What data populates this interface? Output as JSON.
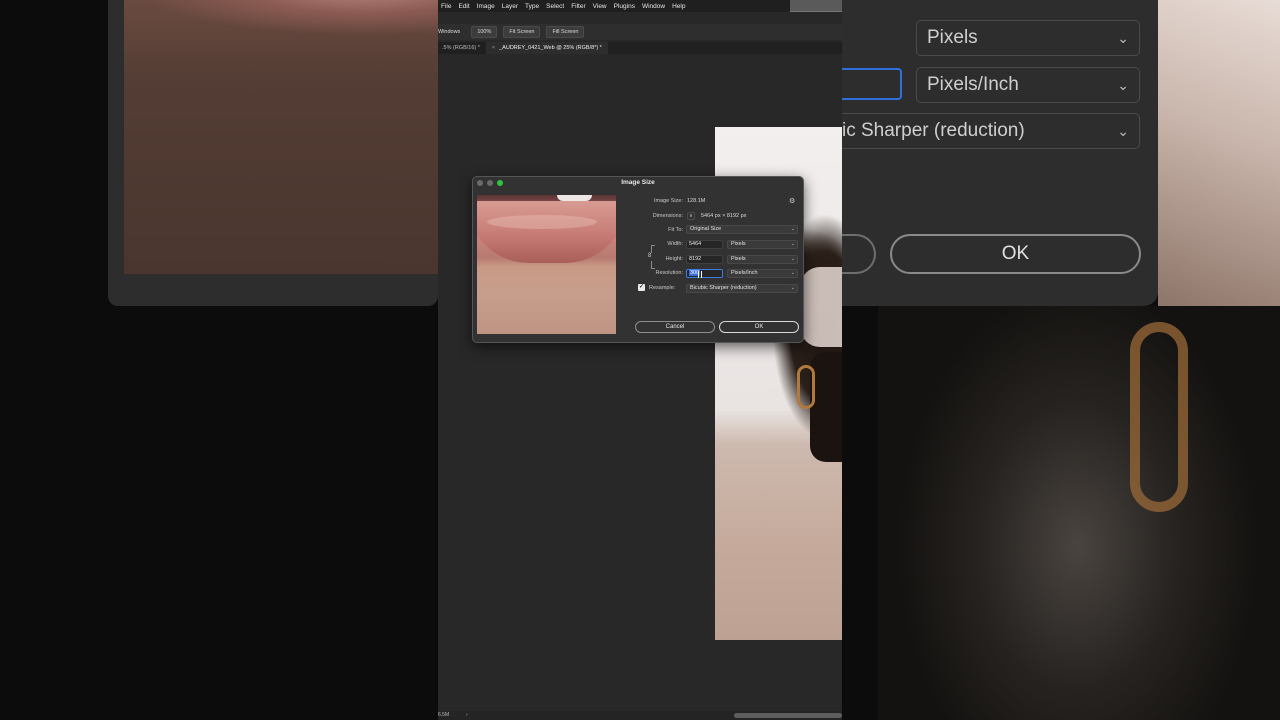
{
  "menu": [
    "File",
    "Edit",
    "Image",
    "Layer",
    "Type",
    "Select",
    "Filter",
    "View",
    "Plugins",
    "Window",
    "Help"
  ],
  "options_bar": {
    "windows_label": "Windows",
    "zoom_100": "100%",
    "fit_screen": "Fit Screen",
    "fill_screen": "Fill Screen"
  },
  "tabs": [
    {
      "label": ".5% (RGB/16) *",
      "close": "",
      "active": false
    },
    {
      "label": "_AUDREY_0421_Web @ 25% (RGB/8*) *",
      "close": "×",
      "active": true
    }
  ],
  "status": {
    "text": "6.5M",
    "arrow": "›"
  },
  "dialog": {
    "title": "Image Size",
    "gear_icon": "⚙",
    "image_size_label": "Image Size:",
    "image_size_value": "128.1M",
    "dimensions_label": "Dimensions:",
    "dimensions_caret": "∨",
    "dimensions_value": "5464 px  ×  8192 px",
    "fit_to_label": "Fit To:",
    "fit_to_value": "Original Size",
    "width_label": "Width:",
    "width_value": "5464",
    "width_unit": "Pixels",
    "height_label": "Height:",
    "height_value": "8192",
    "height_unit": "Pixels",
    "resolution_label": "Resolution:",
    "resolution_value": "300",
    "resolution_unit": "Pixels/Inch",
    "resample_checked": "✓",
    "resample_label": "Resample:",
    "resample_value": "Bicubic Sharper (reduction)",
    "cancel_label": "Cancel",
    "ok_label": "OK",
    "select_caret": "⌄",
    "chain_icon": "8"
  },
  "background_zoom": {
    "unit1": "Pixels",
    "unit2": "Pixels/Inch",
    "resample": "ic Sharper (reduction)",
    "ok": "OK"
  },
  "colors": {
    "accent": "#3a6dd8",
    "zoom_green": "#2ec440",
    "panel": "#323232",
    "canvas": "#282828"
  }
}
